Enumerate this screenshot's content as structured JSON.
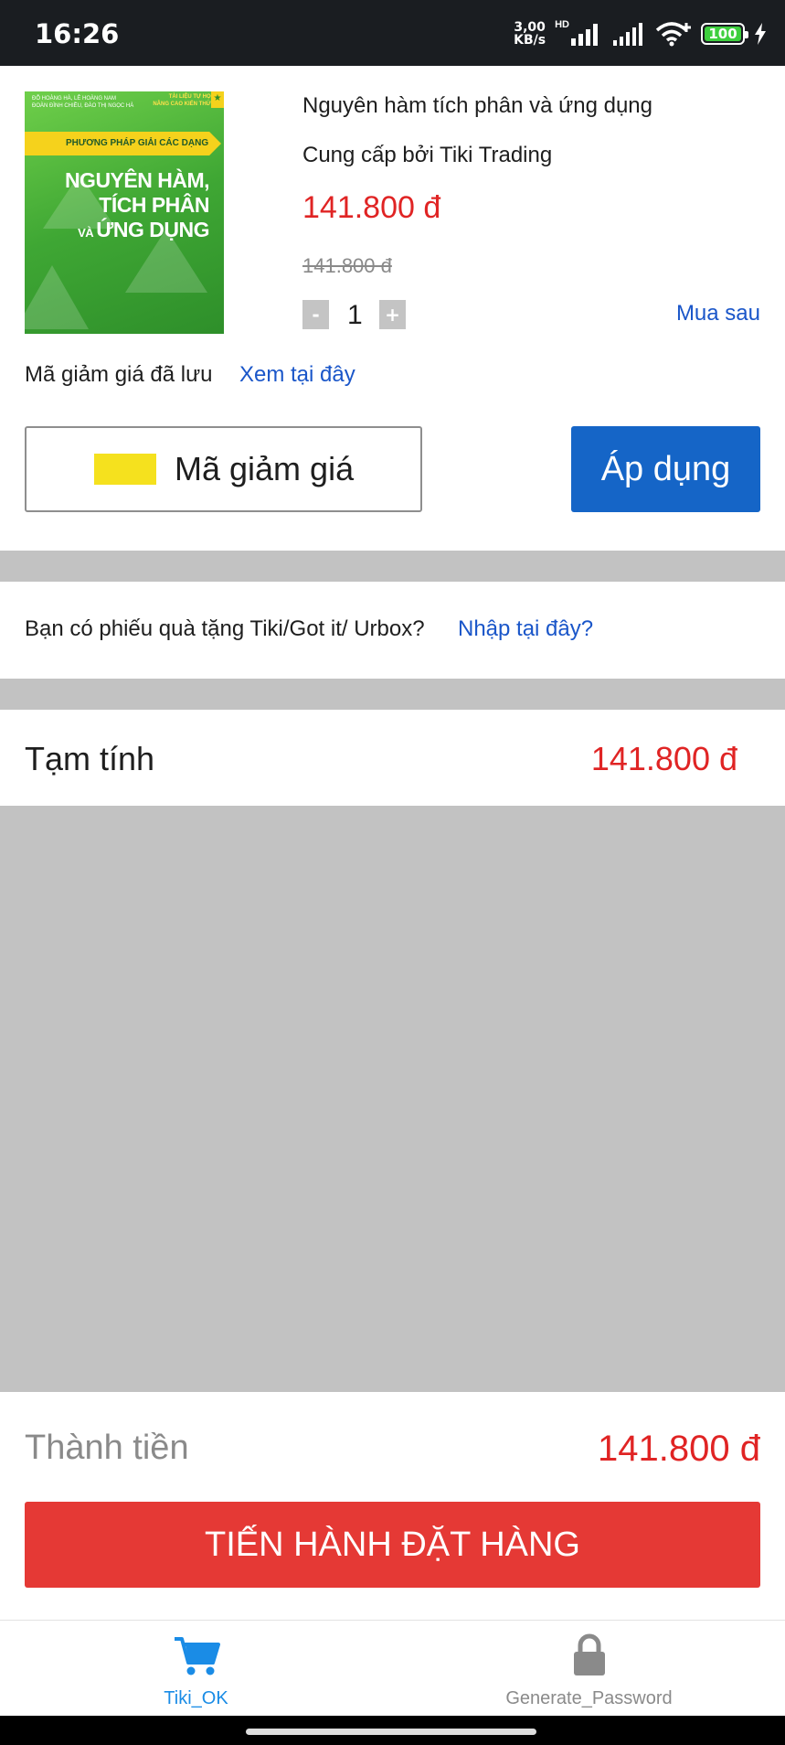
{
  "status_bar": {
    "time": "16:26",
    "net_speed_value": "3,00",
    "net_speed_unit": "KB/s",
    "hd": "HD",
    "battery": "100"
  },
  "product": {
    "title": "Nguyên hàm tích phân và ứng dụng",
    "provider": "Cung cấp bởi Tiki Trading",
    "price": "141.800 đ",
    "original_price": "141.800 đ",
    "quantity": "1",
    "minus_label": "-",
    "plus_label": "+",
    "buy_later": "Mua sau",
    "cover": {
      "top_text": "ĐỖ HOÀNG HÀ, LÊ HOÀNG NAM\nĐOÀN ĐÌNH CHIỀU, ĐÀO THỊ NGỌC HÀ",
      "badge": "TÀI LIỆU TỰ HỌC\nNÂNG CAO KIẾN THỨC",
      "ribbon": "PHƯƠNG PHÁP GIẢI CÁC DẠNG TOÁN THPT",
      "title_line1": "NGUYÊN HÀM,",
      "title_line2": "TÍCH PHÂN",
      "title_line3_small": "VÀ ",
      "title_line3": "ỨNG DỤNG"
    }
  },
  "coupon": {
    "saved_label": "Mã giảm giá đã lưu",
    "saved_link": "Xem tại đây",
    "input_label": "Mã giảm giá",
    "apply_button": "Áp dụng"
  },
  "gift": {
    "text": "Bạn có phiếu quà tặng Tiki/Got it/ Urbox?",
    "link": "Nhập tại đây?"
  },
  "subtotal": {
    "label": "Tạm tính",
    "value": "141.800 đ"
  },
  "checkout": {
    "total_label": "Thành tiền",
    "total_value": "141.800 đ",
    "order_button": "TIẾN HÀNH ĐẶT HÀNG"
  },
  "tabs": [
    {
      "label": "Tiki_OK",
      "icon": "cart-icon",
      "active": true
    },
    {
      "label": "Generate_Password",
      "icon": "lock-icon",
      "active": false
    }
  ],
  "colors": {
    "accent_blue": "#1565c7",
    "price_red": "#e02424",
    "order_red": "#e53935",
    "tab_active": "#1a8ce6",
    "background_gray": "#c2c2c2"
  }
}
